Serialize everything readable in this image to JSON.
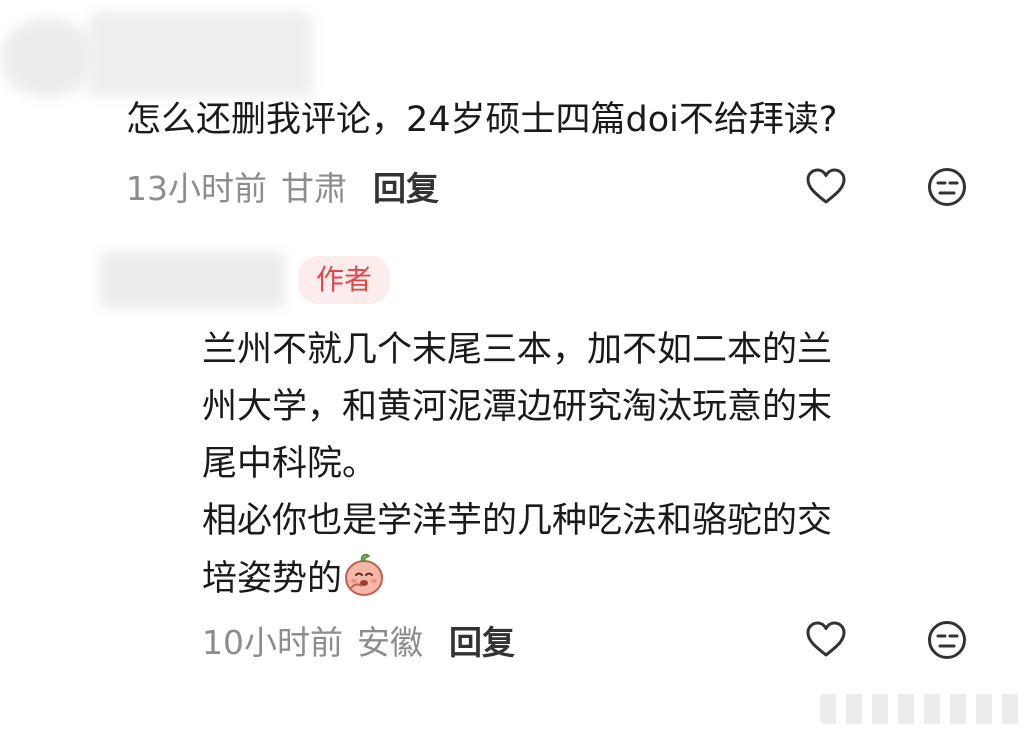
{
  "comment": {
    "text": "怎么还删我评论，24岁硕士四篇doi不给拜读?",
    "time": "13小时前",
    "location": "甘肃",
    "reply_label": "回复",
    "like_icon": "heart-outline-icon",
    "dislike_icon": "neutral-face-icon"
  },
  "reply": {
    "badge": "作者",
    "lines": [
      "兰州不就几个末尾三本，加不如二本的兰",
      "州大学，和黄河泥潭边研究淘汰玩意的末",
      "尾中科院。",
      "相必你也是学洋芋的几种吃法和骆驼的交",
      "培姿势的"
    ],
    "emoji": "laughing-peach-emoji",
    "time": "10小时前",
    "location": "安徽",
    "reply_label": "回复",
    "like_icon": "heart-outline-icon",
    "dislike_icon": "neutral-face-icon"
  },
  "colors": {
    "text": "#1a1a1a",
    "meta": "#8d8d8d",
    "badge_bg": "#fdecec",
    "badge_text": "#e0474a"
  }
}
